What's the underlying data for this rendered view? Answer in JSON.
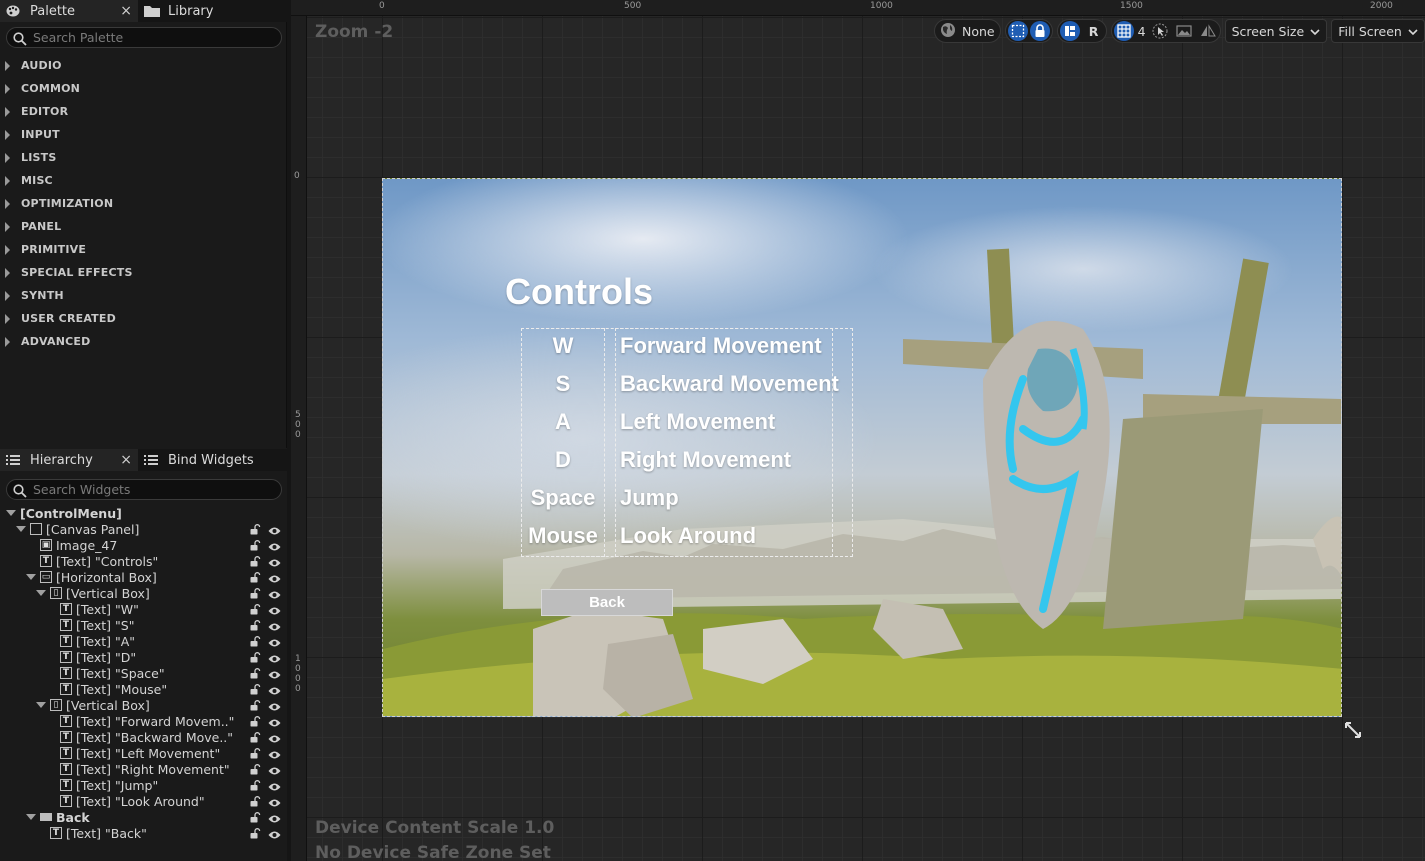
{
  "palette": {
    "tab_label": "Palette",
    "library_tab_label": "Library",
    "search_placeholder": "Search Palette",
    "categories": [
      "AUDIO",
      "COMMON",
      "EDITOR",
      "INPUT",
      "LISTS",
      "MISC",
      "OPTIMIZATION",
      "PANEL",
      "PRIMITIVE",
      "SPECIAL EFFECTS",
      "SYNTH",
      "USER CREATED",
      "ADVANCED"
    ]
  },
  "hierarchy": {
    "tab_label": "Hierarchy",
    "bind_tab_label": "Bind Widgets",
    "search_placeholder": "Search Widgets",
    "items": [
      {
        "label": "[ControlMenu]",
        "icon": "none"
      },
      {
        "label": "[Canvas Panel]",
        "icon": "canvas-panel-icon"
      },
      {
        "label": "Image_47",
        "icon": "image-icon"
      },
      {
        "label": "[Text] \"Controls\"",
        "icon": "text-icon"
      },
      {
        "label": "[Horizontal Box]",
        "icon": "horizontal-box-icon"
      },
      {
        "label": "[Vertical Box]",
        "icon": "vertical-box-icon"
      },
      {
        "label": "[Text] \"W\"",
        "icon": "text-icon"
      },
      {
        "label": "[Text] \"S\"",
        "icon": "text-icon"
      },
      {
        "label": "[Text] \"A\"",
        "icon": "text-icon"
      },
      {
        "label": "[Text] \"D\"",
        "icon": "text-icon"
      },
      {
        "label": "[Text] \"Space\"",
        "icon": "text-icon"
      },
      {
        "label": "[Text] \"Mouse\"",
        "icon": "text-icon"
      },
      {
        "label": "[Vertical Box]",
        "icon": "vertical-box-icon"
      },
      {
        "label": "[Text] \"Forward Movem..\"",
        "icon": "text-icon"
      },
      {
        "label": "[Text] \"Backward Move..\"",
        "icon": "text-icon"
      },
      {
        "label": "[Text] \"Left Movement\"",
        "icon": "text-icon"
      },
      {
        "label": "[Text] \"Right Movement\"",
        "icon": "text-icon"
      },
      {
        "label": "[Text] \"Jump\"",
        "icon": "text-icon"
      },
      {
        "label": "[Text] \"Look Around\"",
        "icon": "text-icon"
      },
      {
        "label": "Back",
        "icon": "button-icon"
      },
      {
        "label": "[Text] \"Back\"",
        "icon": "text-icon"
      }
    ]
  },
  "viewport": {
    "zoom_label": "Zoom -2",
    "ruler_top": [
      "0",
      "500",
      "1000",
      "1500",
      "2000"
    ],
    "ruler_left": [
      "0",
      "500",
      "1000"
    ],
    "toolbar": {
      "localization": "None",
      "r_label": "R",
      "grid_value": "4",
      "screen_size": "Screen Size",
      "fill_screen": "Fill Screen"
    },
    "device_content_scale": "Device Content Scale 1.0",
    "safe_zone": "No Device Safe Zone Set"
  },
  "widget": {
    "title": "Controls",
    "keys": [
      "W",
      "S",
      "A",
      "D",
      "Space",
      "Mouse"
    ],
    "actions": [
      "Forward Movement",
      "Backward Movement",
      "Left Movement",
      "Right Movement",
      "Jump",
      "Look Around"
    ],
    "back_label": "Back"
  },
  "colors": {
    "accent_blue": "#1f5db3",
    "panel_bg": "#1a1a1a",
    "viewport_bg": "#262626"
  }
}
